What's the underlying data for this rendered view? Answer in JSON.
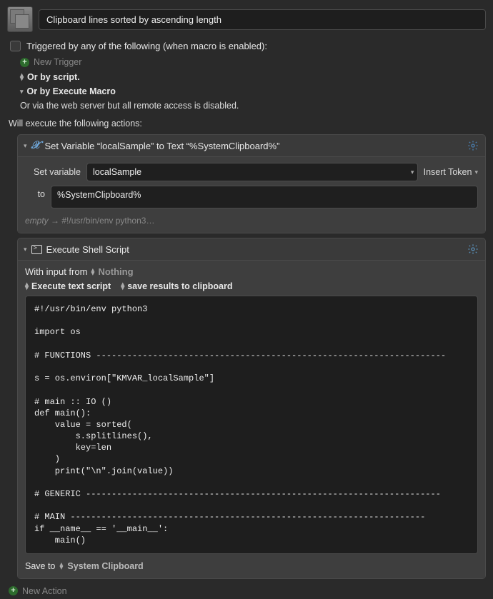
{
  "header": {
    "title": "Clipboard lines sorted by ascending length"
  },
  "trigger": {
    "checkbox_label": "Triggered by any of the following (when macro is enabled):",
    "new_trigger": "New Trigger",
    "or_script": "Or by script.",
    "or_execute": "Or by Execute Macro",
    "or_web": "Or via the web server but all remote access is disabled."
  },
  "exec_label": "Will execute the following actions:",
  "action1": {
    "title": "Set Variable “localSample” to Text “%SystemClipboard%”",
    "set_variable_label": "Set variable",
    "variable_name": "localSample",
    "insert_token": "Insert Token",
    "to_label": "to",
    "to_value": "%SystemClipboard%",
    "hint_empty": "empty",
    "hint_rest": "#!/usr/bin/env python3…"
  },
  "action2": {
    "title": "Execute Shell Script",
    "with_input_label": "With input from",
    "with_input_value": "Nothing",
    "execute_mode": "Execute text script",
    "save_results": "save results to clipboard",
    "script": "#!/usr/bin/env python3\n\nimport os\n\n# FUNCTIONS --------------------------------------------------------------------\n\ns = os.environ[\"KMVAR_localSample\"]\n\n# main :: IO ()\ndef main():\n    value = sorted(\n        s.splitlines(),\n        key=len\n    )\n    print(\"\\n\".join(value))\n\n# GENERIC ---------------------------------------------------------------------\n\n# MAIN ---------------------------------------------------------------------\nif __name__ == '__main__':\n    main()",
    "save_to_label": "Save to",
    "save_to_value": "System Clipboard"
  },
  "footer": {
    "new_action": "New Action"
  }
}
